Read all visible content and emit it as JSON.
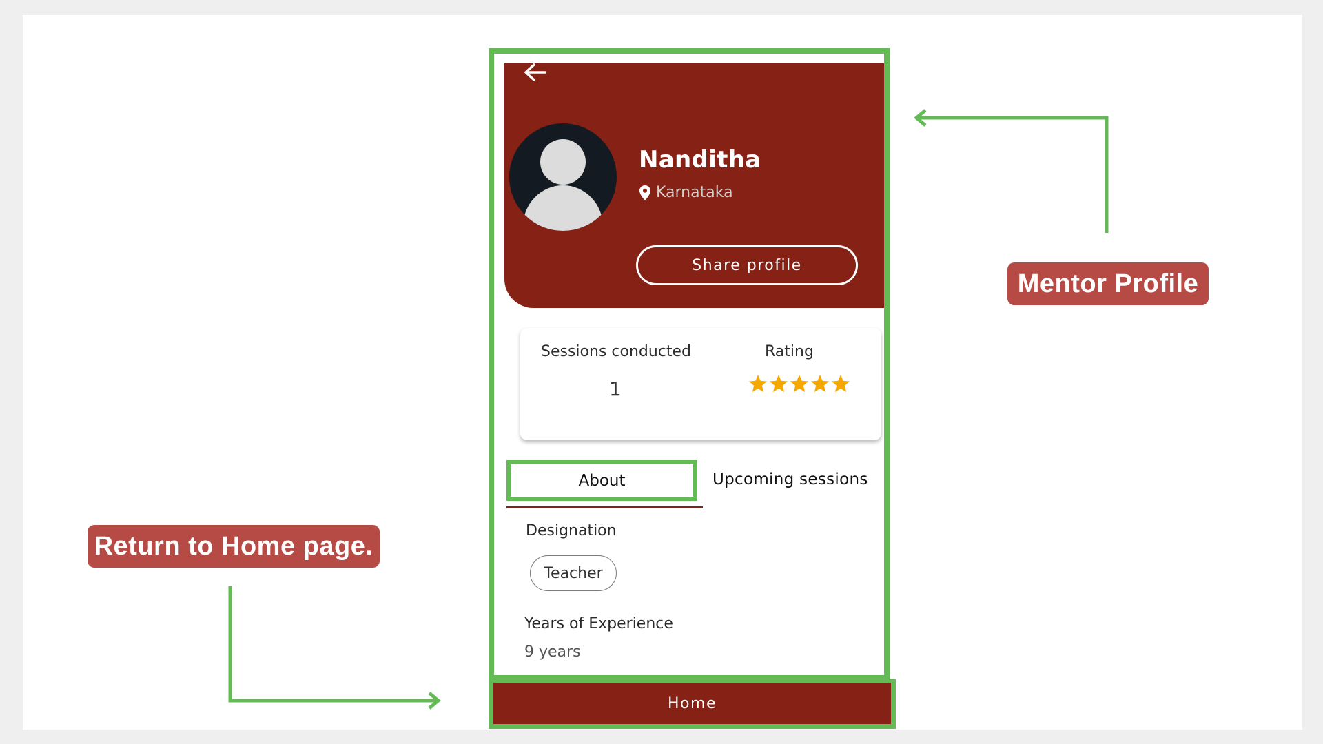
{
  "profile": {
    "name": "Nanditha",
    "location": "Karnataka",
    "share_label": "Share profile"
  },
  "stats": {
    "sessions_label": "Sessions conducted",
    "sessions_value": "1",
    "rating_label": "Rating",
    "rating_value": 5,
    "rating_max": 5
  },
  "tabs": [
    {
      "label": "About",
      "active": true
    },
    {
      "label": "Upcoming sessions",
      "active": false
    }
  ],
  "about": {
    "designation_label": "Designation",
    "designation_value": "Teacher",
    "experience_label": "Years of Experience",
    "experience_value": "9 years"
  },
  "bottom_nav": {
    "home_label": "Home"
  },
  "annotations": {
    "mentor_profile": "Mentor Profile",
    "return_home": "Return to Home page."
  },
  "icons": {
    "back": "back-arrow-icon",
    "location": "location-pin-icon",
    "avatar": "user-avatar-icon",
    "star": "star-icon"
  },
  "colors": {
    "brand": "#862116",
    "highlight": "#64bb55",
    "callout": "#b64a44",
    "star": "#f5a800",
    "background": "#efefef"
  }
}
